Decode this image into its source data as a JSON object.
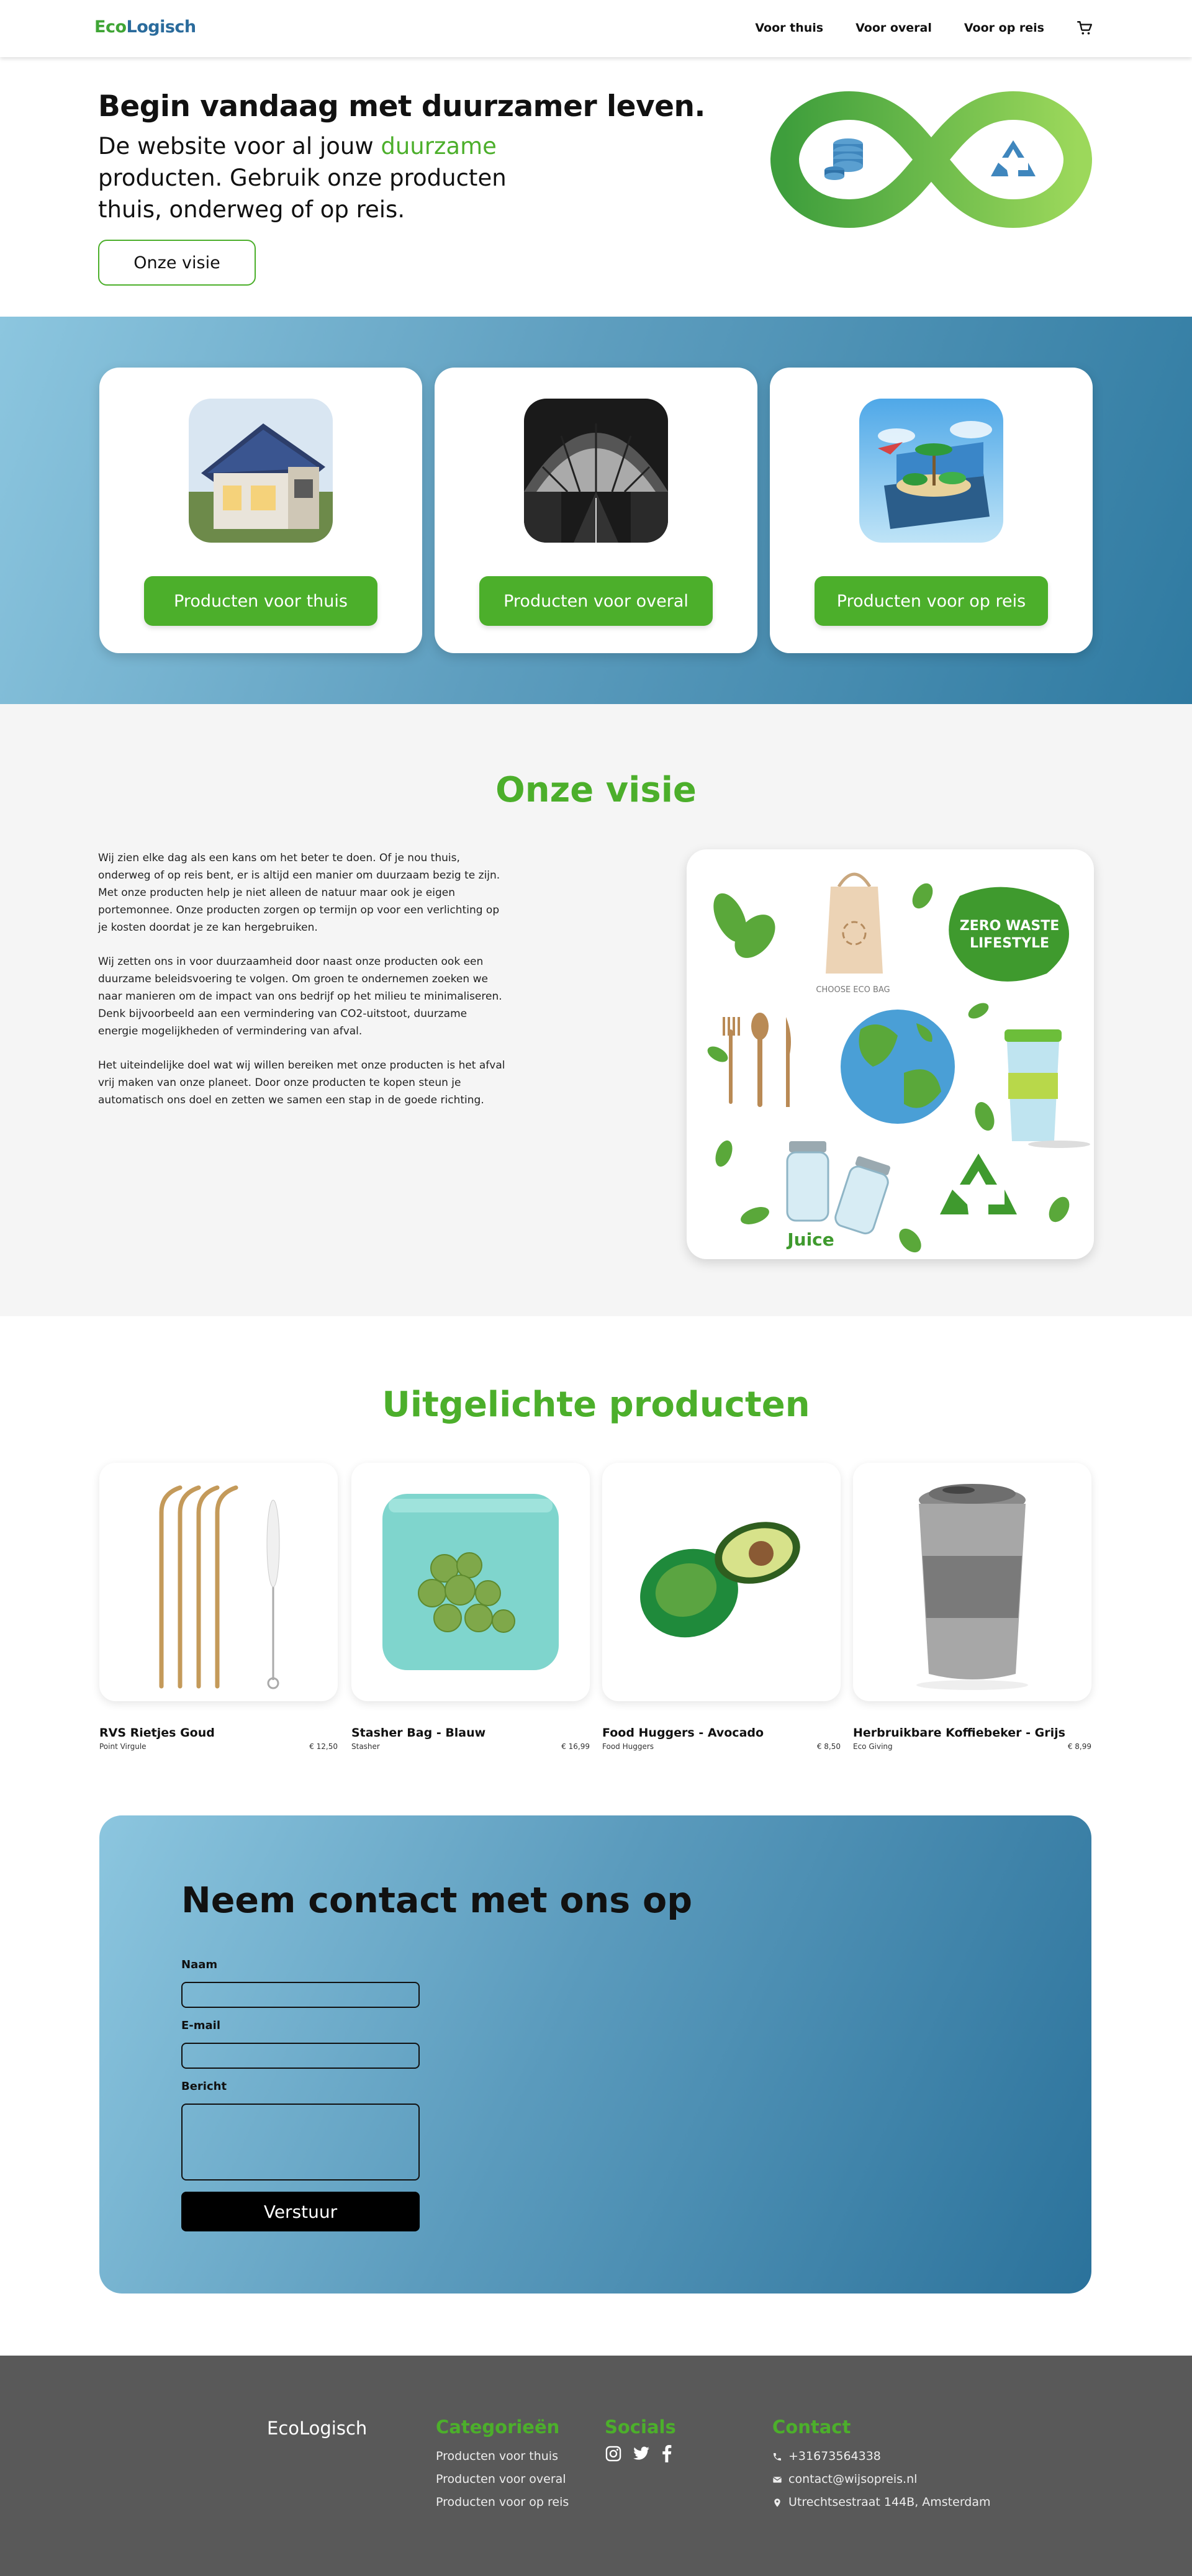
{
  "nav": {
    "logo_eco": "Eco",
    "logo_logisch": "Logisch",
    "links": [
      "Voor thuis",
      "Voor overal",
      "Voor op reis"
    ]
  },
  "hero": {
    "title": "Begin vandaag met duurzamer leven.",
    "sub_before": "De website voor al jouw ",
    "sub_highlight": "duurzame",
    "sub_after": " producten. Gebruik onze producten thuis, onderweg of op reis.",
    "button": "Onze visie"
  },
  "categories": [
    {
      "label": "Producten voor thuis"
    },
    {
      "label": "Producten voor overal"
    },
    {
      "label": "Producten voor op reis"
    }
  ],
  "vision": {
    "title": "Onze visie",
    "paragraphs": [
      "Wij zien elke dag als een kans om het beter te doen. Of je nou thuis, onderweg of op reis bent, er is altijd een manier om duurzaam bezig te zijn. Met onze producten help je niet alleen de natuur maar ook je eigen portemonnee. Onze producten zorgen op termijn op voor een verlichting op je kosten doordat je ze kan hergebruiken.",
      "Wij zetten ons in voor duurzaamheid door naast onze producten ook een duurzame beleidsvoering te volgen. Om groen te ondernemen zoeken we naar manieren om de impact van ons bedrijf op het milieu te minimaliseren. Denk bijvoorbeeld aan een vermindering van CO2-uitstoot, duurzame energie mogelijkheden of vermindering van afval.",
      "Het uiteindelijke doel wat wij willen bereiken met onze producten is het afval vrij maken van onze planeet. Door onze producten te kopen steun je automatisch ons doel en zetten we samen een stap in de goede richting."
    ],
    "poster": {
      "badge_line1": "ZERO WASTE",
      "badge_line2": "LIFESTYLE",
      "bag_text": "CHOOSE ECO BAG",
      "juice_text": "Juice"
    }
  },
  "products": {
    "title": "Uitgelichte producten",
    "items": [
      {
        "name": "RVS Rietjes Goud",
        "brand": "Point Virgule",
        "price": "€ 12,50"
      },
      {
        "name": "Stasher Bag - Blauw",
        "brand": "Stasher",
        "price": "€ 16,99"
      },
      {
        "name": "Food Huggers - Avocado",
        "brand": "Food Huggers",
        "price": "€ 8,50"
      },
      {
        "name": "Herbruikbare Koffiebeker - Grijs",
        "brand": "Eco Giving",
        "price": "€ 8,99"
      }
    ]
  },
  "contact": {
    "title": "Neem contact met ons op",
    "name_label": "Naam",
    "email_label": "E-mail",
    "message_label": "Bericht",
    "send": "Verstuur"
  },
  "footer": {
    "brand": "EcoLogisch",
    "categories_title": "Categorieën",
    "categories": [
      "Producten voor thuis",
      "Producten voor overal",
      "Producten voor op reis"
    ],
    "socials_title": "Socials",
    "socials": [
      "instagram-icon",
      "twitter-icon",
      "facebook-icon"
    ],
    "contact_title": "Contact",
    "phone": "+31673564338",
    "email": "contact@wijsopreis.nl",
    "address": "Utrechtsestraat 144B, Amsterdam"
  },
  "colors": {
    "brand_green": "#4caf2b",
    "brand_blue": "#2a6b9c",
    "footer_bg": "#595959"
  }
}
